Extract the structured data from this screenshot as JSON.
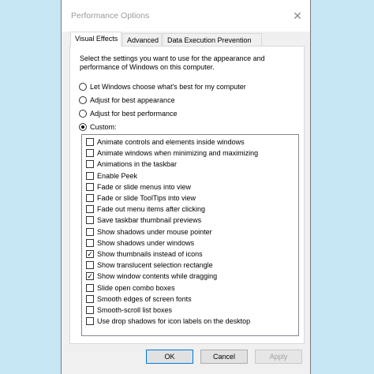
{
  "window": {
    "title": "Performance Options",
    "close_glyph": "✕"
  },
  "tabs": [
    {
      "label": "Visual Effects",
      "active": true
    },
    {
      "label": "Advanced",
      "active": false
    },
    {
      "label": "Data Execution Prevention",
      "active": false
    }
  ],
  "description": "Select the settings you want to use for the appearance and performance of Windows on this computer.",
  "radios": [
    {
      "label": "Let Windows choose what's best for my computer",
      "checked": false
    },
    {
      "label": "Adjust for best appearance",
      "checked": false
    },
    {
      "label": "Adjust for best performance",
      "checked": false
    },
    {
      "label": "Custom:",
      "checked": true
    }
  ],
  "options": [
    {
      "label": "Animate controls and elements inside windows",
      "checked": false
    },
    {
      "label": "Animate windows when minimizing and maximizing",
      "checked": false
    },
    {
      "label": "Animations in the taskbar",
      "checked": false
    },
    {
      "label": "Enable Peek",
      "checked": false
    },
    {
      "label": "Fade or slide menus into view",
      "checked": false
    },
    {
      "label": "Fade or slide ToolTips into view",
      "checked": false
    },
    {
      "label": "Fade out menu items after clicking",
      "checked": false
    },
    {
      "label": "Save taskbar thumbnail previews",
      "checked": false
    },
    {
      "label": "Show shadows under mouse pointer",
      "checked": false
    },
    {
      "label": "Show shadows under windows",
      "checked": false
    },
    {
      "label": "Show thumbnails instead of icons",
      "checked": true
    },
    {
      "label": "Show translucent selection rectangle",
      "checked": false
    },
    {
      "label": "Show window contents while dragging",
      "checked": true
    },
    {
      "label": "Slide open combo boxes",
      "checked": false
    },
    {
      "label": "Smooth edges of screen fonts",
      "checked": false
    },
    {
      "label": "Smooth-scroll list boxes",
      "checked": false
    },
    {
      "label": "Use drop shadows for icon labels on the desktop",
      "checked": false
    }
  ],
  "buttons": {
    "ok": "OK",
    "cancel": "Cancel",
    "apply": "Apply"
  },
  "colors": {
    "background": "#c7e6f4",
    "dialog": "#f0f0f0",
    "accent": "#0078d7"
  }
}
